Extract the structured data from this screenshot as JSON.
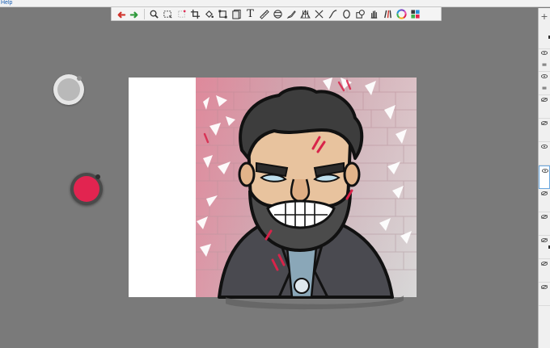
{
  "menubar": {
    "help_label": "Help"
  },
  "toolbar": {
    "tools": [
      {
        "name": "undo-icon",
        "color": "#d0342c"
      },
      {
        "name": "redo-icon",
        "color": "#2f9a3b"
      },
      {
        "name": "zoom-icon"
      },
      {
        "name": "select-rect-icon"
      },
      {
        "name": "select-lasso-icon"
      },
      {
        "name": "crop-icon"
      },
      {
        "name": "fill-icon"
      },
      {
        "name": "transform-icon"
      },
      {
        "name": "layer-stack-icon"
      },
      {
        "name": "text-icon",
        "label": "T"
      },
      {
        "name": "ruler-icon"
      },
      {
        "name": "symmetry-icon"
      },
      {
        "name": "brush-icon"
      },
      {
        "name": "perspective-grid-icon"
      },
      {
        "name": "distort-icon"
      },
      {
        "name": "curve-icon"
      },
      {
        "name": "ellipse-icon"
      },
      {
        "name": "shape-icon"
      },
      {
        "name": "hand-icon"
      },
      {
        "name": "brush-library-icon"
      },
      {
        "name": "color-wheel-icon"
      },
      {
        "name": "swatches-icon"
      }
    ]
  },
  "text_tool_label": "T",
  "pucks": {
    "color_puck_fill": "#e22450",
    "brush_puck_fill": "#b9b9b9"
  },
  "layers_panel": {
    "add_label": "+"
  },
  "colors": {
    "background": "#7a7a7a",
    "accent_red": "#e22450"
  }
}
